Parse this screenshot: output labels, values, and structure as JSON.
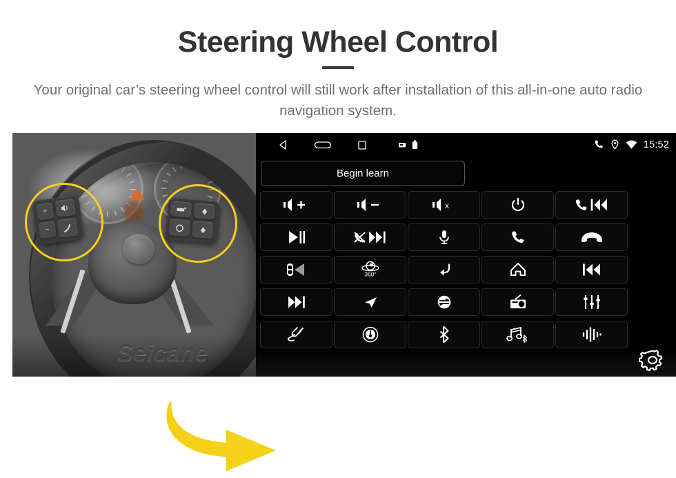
{
  "header": {
    "title": "Steering Wheel Control",
    "subtitle": "Your original car’s steering wheel control will still work after installation of this all-in-one auto radio navigation system."
  },
  "photo": {
    "watermark": "Seicane",
    "highlight_color": "#f5d117",
    "arrow_color": "#f5d117",
    "description": "Grayscale close-up of a car steering wheel with left and right multifunction button clusters circled in yellow"
  },
  "screen": {
    "background_color": "#000000",
    "statusbar": {
      "nav": [
        {
          "name": "back-icon",
          "label": "Back"
        },
        {
          "name": "home-icon",
          "label": "Home"
        },
        {
          "name": "recents-icon",
          "label": "Recents"
        },
        {
          "name": "sdcard-icon",
          "label": "SD card"
        },
        {
          "name": "battery-icon",
          "label": "Battery"
        }
      ],
      "indicators": [
        {
          "name": "phone-icon",
          "label": "Phone"
        },
        {
          "name": "location-icon",
          "label": "Location"
        },
        {
          "name": "wifi-icon",
          "label": "Wi-Fi"
        }
      ],
      "time": "15:52"
    },
    "begin_learn_label": "Begin learn",
    "settings_label": "Settings",
    "grid": [
      [
        {
          "name": "volume-up-button",
          "icon": "volume-up-icon",
          "label": "Volume up"
        },
        {
          "name": "volume-down-button",
          "icon": "volume-down-icon",
          "label": "Volume down"
        },
        {
          "name": "mute-button",
          "icon": "volume-mute-icon",
          "label": "Mute"
        },
        {
          "name": "power-button",
          "icon": "power-icon",
          "label": "Power"
        },
        {
          "name": "call-previous-button",
          "icon": "phone-previous-icon",
          "label": "Call / previous"
        }
      ],
      [
        {
          "name": "play-pause-button",
          "icon": "play-pause-icon",
          "label": "Play / pause"
        },
        {
          "name": "decline-next-button",
          "icon": "phone-decline-next-icon",
          "label": "Decline / next"
        },
        {
          "name": "voice-button",
          "icon": "microphone-icon",
          "label": "Voice command"
        },
        {
          "name": "answer-call-button",
          "icon": "phone-answer-icon",
          "label": "Answer call"
        },
        {
          "name": "end-call-button",
          "icon": "phone-hangup-icon",
          "label": "End call"
        }
      ],
      [
        {
          "name": "parking-sensor-button",
          "icon": "car-speaker-icon",
          "label": "Parking sensor"
        },
        {
          "name": "camera-360-button",
          "icon": "camera-360-icon",
          "label": "360 camera",
          "text": "360°"
        },
        {
          "name": "back-button",
          "icon": "return-arrow-icon",
          "label": "Back"
        },
        {
          "name": "home-button",
          "icon": "house-icon",
          "label": "Home"
        },
        {
          "name": "previous-track-button",
          "icon": "previous-track-icon",
          "label": "Previous track"
        }
      ],
      [
        {
          "name": "next-track-button",
          "icon": "next-track-icon",
          "label": "Next track"
        },
        {
          "name": "navigation-button",
          "icon": "navigation-arrow-icon",
          "label": "Navigation"
        },
        {
          "name": "mode-button",
          "icon": "mode-circle-icon",
          "label": "Mode"
        },
        {
          "name": "radio-button",
          "icon": "radio-icon",
          "label": "Radio"
        },
        {
          "name": "equalizer-button",
          "icon": "equalizer-icon",
          "label": "Equalizer"
        }
      ],
      [
        {
          "name": "aux-button",
          "icon": "cable-plug-icon",
          "label": "AUX"
        },
        {
          "name": "dial-button",
          "icon": "dial-knob-icon",
          "label": "Dial"
        },
        {
          "name": "bluetooth-button",
          "icon": "bluetooth-icon",
          "label": "Bluetooth"
        },
        {
          "name": "bluetooth-music-button",
          "icon": "music-bluetooth-icon",
          "label": "Bluetooth music"
        },
        {
          "name": "sound-button",
          "icon": "waveform-icon",
          "label": "Sound"
        }
      ]
    ]
  },
  "colors": {
    "title": "#333333",
    "subtitle": "#6f6f6f",
    "accent_yellow": "#f5d117",
    "screen_bg": "#000000"
  }
}
